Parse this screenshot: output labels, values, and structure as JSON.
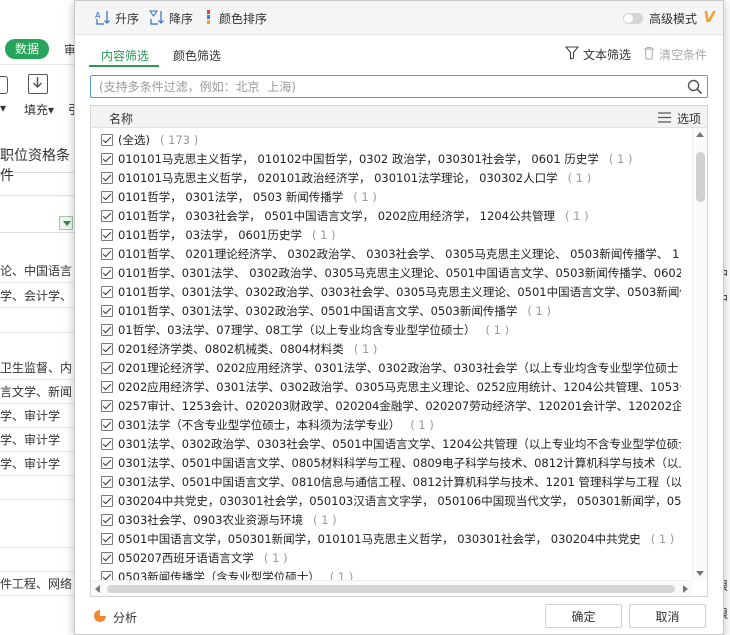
{
  "background": {
    "tab_active": "数据",
    "tab_next": "审",
    "fill_label": "填充",
    "left_fragment": "引",
    "header_text": "职位资格条件",
    "rows": [
      "论、中国语言",
      "学、会计学、",
      "",
      "卫生监督、内",
      "言文学、新闻",
      "学、审计学",
      "学、审计学",
      "学、审计学",
      "",
      "",
      "",
      "件工程、网络"
    ],
    "right_rows": [
      "中",
      "中",
      "",
      "",
      "",
      "",
      "",
      "",
      "",
      "",
      "",
      "",
      "",
      "",
      "",
      "",
      "",
      "",
      "",
      "",
      "限",
      "限"
    ]
  },
  "toolbar": {
    "sort_asc": "升序",
    "sort_desc": "降序",
    "color_sort": "颜色排序",
    "advanced_mode": "高级模式",
    "v_badge": "V"
  },
  "tabs": {
    "content_filter": "内容筛选",
    "color_filter": "颜色筛选",
    "text_filter": "文本筛选",
    "clear_conditions": "清空条件"
  },
  "search": {
    "placeholder": "(支持多条件过滤，例如：北京  上海)"
  },
  "list": {
    "header_name": "名称",
    "header_options": "选项",
    "items": [
      {
        "text": "(全选)",
        "count": "( 173 )"
      },
      {
        "text": "010101马克思主义哲学， 010102中国哲学，0302 政治学，030301社会学， 0601 历史学",
        "count": "( 1 )"
      },
      {
        "text": "010101马克思主义哲学， 020101政治经济学， 030101法学理论， 030302人口学",
        "count": "( 1 )"
      },
      {
        "text": "0101哲学， 0301法学， 0503 新闻传播学",
        "count": "( 1 )"
      },
      {
        "text": "0101哲学， 0303社会学， 0501中国语言文学， 0202应用经济学， 1204公共管理",
        "count": "( 1 )"
      },
      {
        "text": "0101哲学， 03法学， 0601历史学",
        "count": "( 1 )"
      },
      {
        "text": "0101哲学、 0201理论经济学、 0302政治学、 0303社会学、 0305马克思主义理论、 0503新闻传播学、 1",
        "count": ""
      },
      {
        "text": "0101哲学、0301法学、 0302政治学、0305马克思主义理论、0501中国语言文学、0503新闻传播学、0602中",
        "count": ""
      },
      {
        "text": "0101哲学、0301法学、0302政治学、0303社会学、0305马克思主义理论、0501中国语言文学、0503新闻传",
        "count": ""
      },
      {
        "text": "0101哲学、0301法学、0302政治学、0501中国语言文学、0503新闻传播学",
        "count": "( 1 )"
      },
      {
        "text": "01哲学、03法学、07理学、08工学（以上专业均含专业型学位硕士）",
        "count": "( 1 )"
      },
      {
        "text": "0201经济学类、0802机械类、0804材料类",
        "count": "( 1 )"
      },
      {
        "text": "0201理论经济学、0202应用经济学、0301法学、0302政治学、0303社会学（以上专业均含专业型学位硕士",
        "count": ""
      },
      {
        "text": "0202应用经济学、0301法学、0302政治学、0305马克思主义理论、0252应用统计、1204公共管理、1053公共",
        "count": ""
      },
      {
        "text": "0257审计、1253会计、020203财政学、020204金融学、020207劳动经济学、120201会计学、120202企业管理",
        "count": ""
      },
      {
        "text": "0301法学（不含专业型学位硕士，本科须为法学专业）",
        "count": "( 1 )"
      },
      {
        "text": "0301法学、0302政治学、0303社会学、0501中国语言文学、1204公共管理（以上专业均不含专业型学位硕士",
        "count": ""
      },
      {
        "text": "0301法学、0501中国语言文学、0805材料科学与工程、0809电子科学与技术、0812计算机科学与技术（以上",
        "count": ""
      },
      {
        "text": "0301法学、0501中国语言文学、0810信息与通信工程、0812计算机科学与技术、1201 管理科学与工程（以",
        "count": ""
      },
      {
        "text": "030204中共党史，030301社会学，050103汉语言文字学， 050106中国现当代文学， 050301新闻学，05030",
        "count": ""
      },
      {
        "text": "0303社会学、0903农业资源与环境",
        "count": "( 1 )"
      },
      {
        "text": "0501中国语言文学，050301新闻学，010101马克思主义哲学， 030301社会学， 030204中共党史",
        "count": "( 1 )"
      },
      {
        "text": "050207西班牙语语言文学",
        "count": "( 1 )"
      },
      {
        "text": "0503新闻传播学（含专业型学位硕士）",
        "count": "( 1 )"
      }
    ]
  },
  "footer": {
    "analyze": "分析",
    "ok": "确定",
    "cancel": "取消"
  },
  "colors": {
    "accent_green": "#2a9a52",
    "search_border": "#5a9fd6",
    "badge_orange": "#f0a030"
  }
}
